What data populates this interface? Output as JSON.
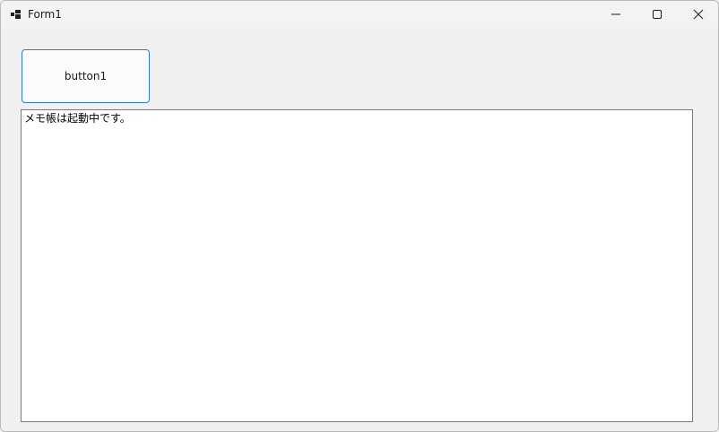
{
  "window": {
    "title": "Form1",
    "icon": "form-app-icon",
    "controls": {
      "minimize_icon": "minimize-icon",
      "maximize_icon": "maximize-icon",
      "close_icon": "close-icon"
    }
  },
  "form": {
    "button_label": "button1",
    "textbox_text": "メモ帳は起動中です。"
  },
  "colors": {
    "window_bg": "#f0f0f0",
    "button_border": "#2f7ec4",
    "textbox_border": "#7a7a7a"
  }
}
